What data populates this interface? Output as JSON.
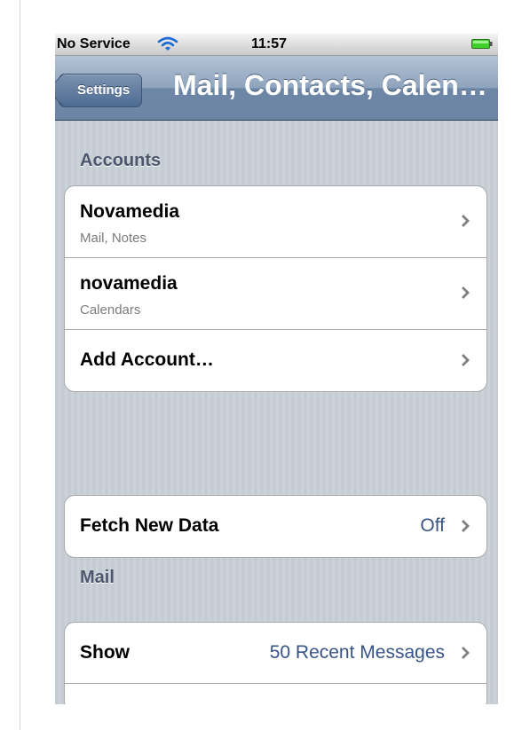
{
  "status_bar": {
    "carrier": "No Service",
    "time": "11:57",
    "wifi_icon": "wifi-icon",
    "battery_icon": "battery-icon"
  },
  "nav": {
    "back_label": "Settings",
    "title": "Mail, Contacts, Calen…"
  },
  "sections": {
    "accounts": {
      "header": "Accounts",
      "rows": [
        {
          "title": "Novamedia",
          "subtitle": "Mail, Notes"
        },
        {
          "title": "novamedia",
          "subtitle": "Calendars"
        },
        {
          "title": "Add Account…"
        }
      ]
    },
    "fetch": {
      "title": "Fetch New Data",
      "value": "Off"
    },
    "mail": {
      "header": "Mail",
      "rows": [
        {
          "title": "Show",
          "value": "50 Recent Messages"
        }
      ]
    }
  },
  "colors": {
    "background": "#c5ccd4",
    "navbar": "#6f87a6",
    "value_blue": "#385487",
    "section_header": "#4c566c"
  }
}
